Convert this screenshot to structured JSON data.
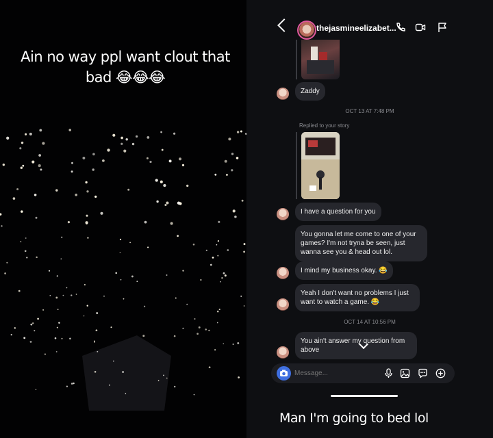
{
  "left_story": {
    "caption": "Ain no way ppl want clout that bad 😂😂😂"
  },
  "dm": {
    "header": {
      "username": "thejasmineelizabet...",
      "icons": [
        "back-chevron-icon",
        "phone-icon",
        "video-icon",
        "flag-icon"
      ]
    },
    "messages": [
      {
        "id": "m1",
        "text": "Zaddy"
      },
      {
        "id": "m2",
        "text": "I have a question for you"
      },
      {
        "id": "m3",
        "text": "You gonna let me come to one of your games? I'm not tryna be seen, just wanna see you & head out lol."
      },
      {
        "id": "m4",
        "text": "I mind my business okay. 😂"
      },
      {
        "id": "m5",
        "text": "Yeah I don't want no problems I just want to watch a game. 😂"
      },
      {
        "id": "m6",
        "text": "You ain't answer my question from above"
      }
    ],
    "timestamps": {
      "t1": "OCT 13 AT 7:48 PM",
      "t2": "OCT 14 AT 10:56 PM"
    },
    "replied_label": "Replied to your story",
    "composer": {
      "placeholder": "Message...",
      "icons": [
        "camera-icon",
        "microphone-icon",
        "gallery-icon",
        "sticker-icon",
        "plus-icon"
      ]
    }
  },
  "bottom_caption": "Man I'm going to bed lol",
  "colors": {
    "camera_accent": "#3f6fe0",
    "bubble_bg": "#26272d",
    "background": "#0e0f12"
  }
}
